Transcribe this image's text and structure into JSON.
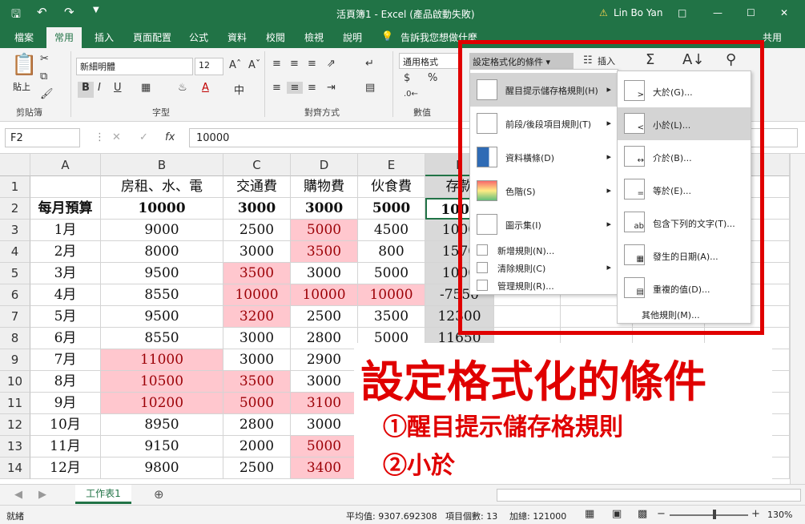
{
  "window": {
    "title": "活頁簿1 - Excel (產品啟動失敗)",
    "user": "Lin Bo Yan",
    "share": "共用"
  },
  "tabs": [
    "檔案",
    "常用",
    "插入",
    "頁面配置",
    "公式",
    "資料",
    "校閱",
    "檢視",
    "說明"
  ],
  "tell_me": "告訴我您想做什麼",
  "ribbon": {
    "paste": "貼上",
    "clipboard": "剪貼簿",
    "font_name": "新細明體",
    "font_size": "12",
    "font_group": "字型",
    "align_group": "對齊方式",
    "number_format": "通用格式",
    "number_group": "數值",
    "cond_format": "設定格式化的條件",
    "insert": "插入",
    "bold": "B",
    "italic": "I",
    "underline": "U"
  },
  "formula_bar": {
    "cell_ref": "F2",
    "value": "10000",
    "fx": "fx"
  },
  "columns": [
    "A",
    "B",
    "C",
    "D",
    "E",
    "F"
  ],
  "rows": [
    {
      "n": "1",
      "a": "",
      "b": "房租、水、電",
      "c": "交通費",
      "d": "購物費",
      "e": "伙食費",
      "f": "存款"
    },
    {
      "n": "2",
      "a": "每月預算",
      "b": "10000",
      "c": "3000",
      "d": "3000",
      "e": "5000",
      "f": "1000"
    },
    {
      "n": "3",
      "a": "1月",
      "b": "9000",
      "c": "2500",
      "d": "5000",
      "e": "4500",
      "f": "1000"
    },
    {
      "n": "4",
      "a": "2月",
      "b": "8000",
      "c": "3000",
      "d": "3500",
      "e": "800",
      "f": "1570"
    },
    {
      "n": "5",
      "a": "3月",
      "b": "9500",
      "c": "3500",
      "d": "3000",
      "e": "5000",
      "f": "1000"
    },
    {
      "n": "6",
      "a": "4月",
      "b": "8550",
      "c": "10000",
      "d": "10000",
      "e": "10000",
      "f": "-7550"
    },
    {
      "n": "7",
      "a": "5月",
      "b": "9500",
      "c": "3200",
      "d": "2500",
      "e": "3500",
      "f": "12300"
    },
    {
      "n": "8",
      "a": "6月",
      "b": "8550",
      "c": "3000",
      "d": "2800",
      "e": "5000",
      "f": "11650"
    },
    {
      "n": "9",
      "a": "7月",
      "b": "11000",
      "c": "3000",
      "d": "2900",
      "e": "",
      "f": ""
    },
    {
      "n": "10",
      "a": "8月",
      "b": "10500",
      "c": "3500",
      "d": "3000",
      "e": "",
      "f": ""
    },
    {
      "n": "11",
      "a": "9月",
      "b": "10200",
      "c": "5000",
      "d": "3100",
      "e": "",
      "f": ""
    },
    {
      "n": "12",
      "a": "10月",
      "b": "8950",
      "c": "2800",
      "d": "3000",
      "e": "",
      "f": ""
    },
    {
      "n": "13",
      "a": "11月",
      "b": "9150",
      "c": "2000",
      "d": "5000",
      "e": "",
      "f": ""
    },
    {
      "n": "14",
      "a": "12月",
      "b": "9800",
      "c": "2500",
      "d": "3400",
      "e": "",
      "f": ""
    }
  ],
  "menu_main": [
    {
      "label": "醒目提示儲存格規則(H)",
      "sub": true
    },
    {
      "label": "前段/後段項目規則(T)",
      "sub": true
    },
    {
      "label": "資料橫條(D)",
      "sub": true
    },
    {
      "label": "色階(S)",
      "sub": true
    },
    {
      "label": "圖示集(I)",
      "sub": true
    },
    {
      "label": "新增規則(N)...",
      "sub": false
    },
    {
      "label": "清除規則(C)",
      "sub": true
    },
    {
      "label": "管理規則(R)...",
      "sub": false
    }
  ],
  "menu_sub": [
    "大於(G)...",
    "小於(L)...",
    "介於(B)...",
    "等於(E)...",
    "包含下列的文字(T)...",
    "發生的日期(A)...",
    "重複的值(D)...",
    "其他規則(M)..."
  ],
  "annotation": {
    "title": "設定格式化的條件",
    "step1": "①醒目提示儲存格規則",
    "step2": "②小於"
  },
  "sheet": {
    "tab": "工作表1"
  },
  "status": {
    "ready": "就緒",
    "average": "平均值: 9307.692308",
    "count": "項目個數: 13",
    "sum": "加總: 121000",
    "zoom": "130%"
  },
  "colors": {
    "excel_green": "#217346",
    "highlight_fill": "#ffc7ce",
    "highlight_text": "#9c0006",
    "annotation_red": "#e00000"
  }
}
